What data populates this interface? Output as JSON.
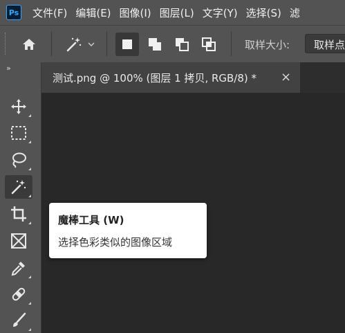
{
  "app": {
    "logo_text": "Ps"
  },
  "menu": [
    "文件(F)",
    "编辑(E)",
    "图像(I)",
    "图层(L)",
    "文字(Y)",
    "选择(S)",
    "滤"
  ],
  "options_bar": {
    "home_icon": "home-icon",
    "tool_preset_icon": "magic-wand-icon",
    "selection_modes": [
      "new-selection",
      "add-to-selection",
      "subtract-from-selection",
      "intersect-selection"
    ],
    "sample_size_label": "取样大小:",
    "sample_size_value": "取样点"
  },
  "toolbar": {
    "collapse_label": "››",
    "tools": [
      "move",
      "rectangular-marquee",
      "lasso",
      "magic-wand",
      "crop",
      "frame",
      "eyedropper",
      "spot-healing-brush",
      "brush"
    ],
    "active_tool": "magic-wand"
  },
  "document_tab": {
    "title": "测试.png @ 100% (图层 1 拷贝, RGB/8) *",
    "close_label": "×"
  },
  "tooltip": {
    "title": "魔棒工具 (W)",
    "description": "选择色彩类似的图像区域"
  },
  "colors": {
    "panel": "#535353",
    "canvas": "#282828",
    "tab_active": "#424242",
    "logo_blue": "#31a8ff"
  }
}
